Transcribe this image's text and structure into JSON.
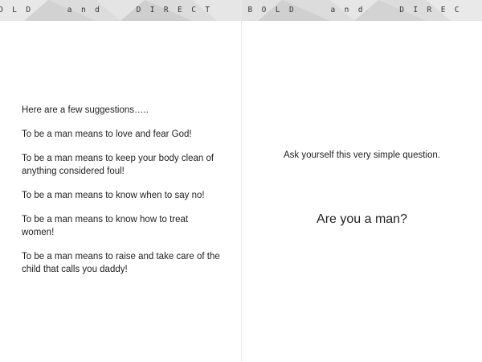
{
  "left_page": {
    "banner_text": "O  L  D        a  n  d        D  I  R  E  C  T",
    "paragraphs": [
      "Here are a few suggestions…..",
      "To be a man means to love and fear God!",
      "To be a man means to keep your body clean of anything considered foul!",
      "To be a man means to know when to say no!",
      "To be a man means to know how to treat women!",
      "To be a man means to raise and take care of the child that calls you daddy!"
    ]
  },
  "right_page": {
    "banner_text": "B  O  L  D        a  n  d        D  I  R  E  C",
    "question": "Ask yourself this very simple question.",
    "answer": "Are you a man?"
  },
  "colors": {
    "banner_bg": "#dcdcdc",
    "text": "#222222"
  }
}
